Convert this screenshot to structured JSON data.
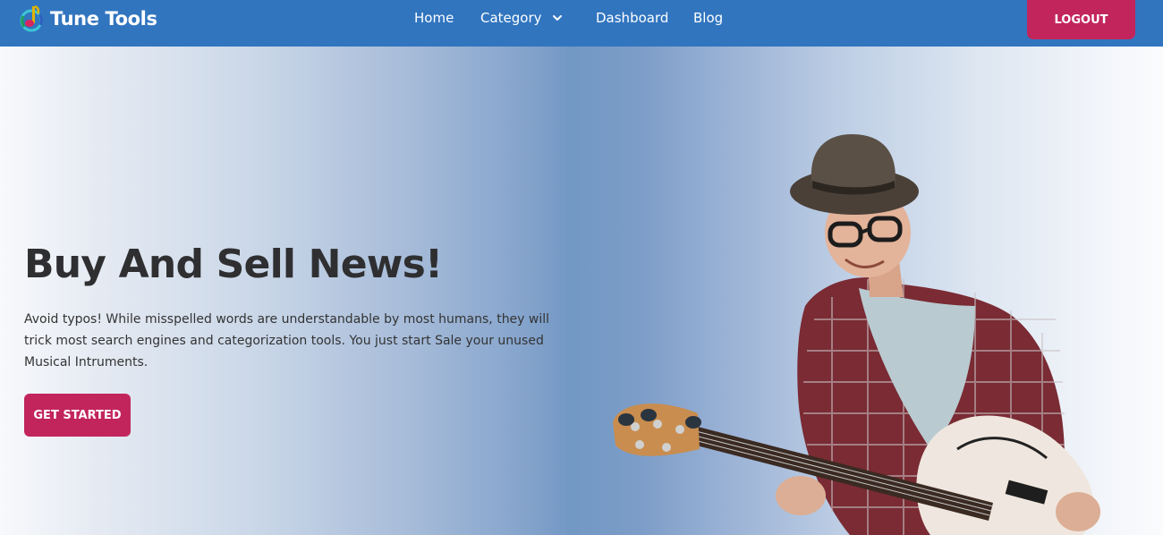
{
  "brand": {
    "name": "Tune Tools",
    "logo_icon": "music-note-icon"
  },
  "nav": {
    "home": "Home",
    "category": "Category",
    "dashboard": "Dashboard",
    "blog": "Blog",
    "logout": "LOGOUT"
  },
  "hero": {
    "title": "Buy And Sell News!",
    "description": "Avoid typos! While misspelled words are understandable by most humans, they will trick most search engines and categorization tools. You just start Sale your unused Musical Intruments.",
    "cta": "GET STARTED",
    "image_icon": "guitarist-photo"
  },
  "colors": {
    "navbar": "#3175bf",
    "accent": "#c2255c",
    "title": "#2f2f31"
  }
}
